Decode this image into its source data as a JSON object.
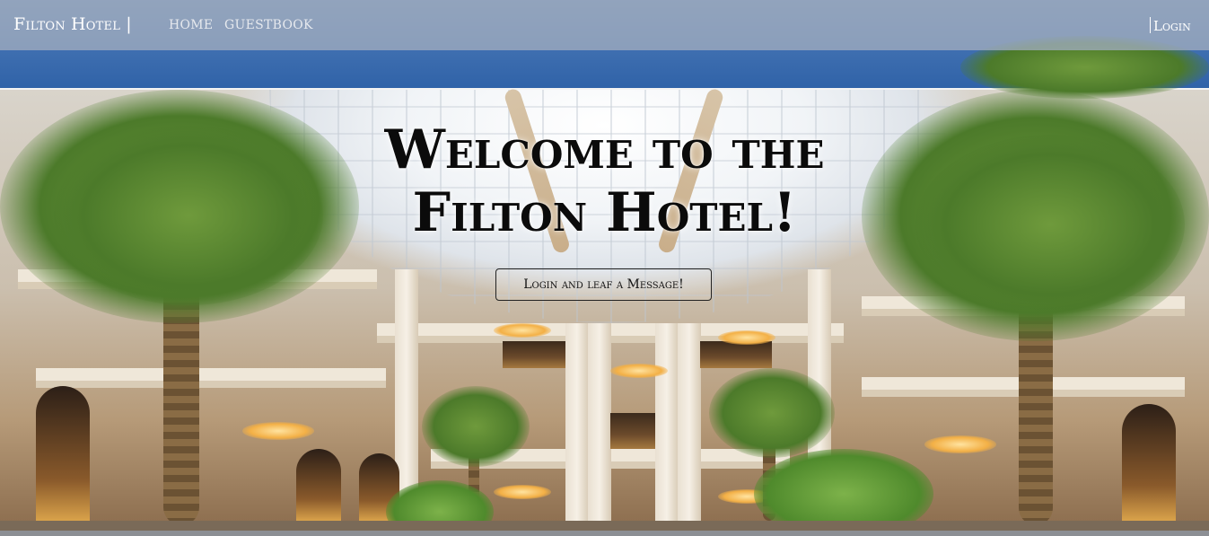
{
  "navbar": {
    "brand": "Filton Hotel |",
    "links": [
      {
        "label": "Home"
      },
      {
        "label": "Guestbook"
      }
    ],
    "login_label": "Login"
  },
  "hero": {
    "title_line1": "Welcome to the",
    "title_line2": "Filton Hotel!",
    "cta_label": "Login and leaf a Message!"
  },
  "background": {
    "image_subject": "hotel-atrium-with-palm-trees",
    "sky_color": "#3f6fb0",
    "navbar_color": "#a0acbe"
  }
}
